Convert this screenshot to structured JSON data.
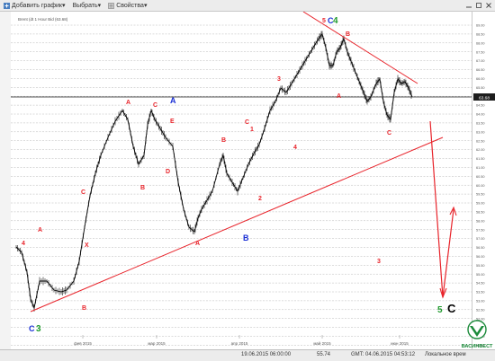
{
  "toolbar": {
    "add_chart_label": "Добавить график",
    "select_label": "Выбрать",
    "properties_label": "Свойства"
  },
  "chart": {
    "legend": "Brent (dt 1 Hour Bid (63.68)",
    "price_badge": "63.68",
    "x_labels": [
      "фев 2015",
      "мар 2015",
      "апр 2015",
      "май 2015",
      "июн 2015"
    ],
    "y_labels": [
      "69.00",
      "68.50",
      "68.00",
      "67.50",
      "67.00",
      "66.50",
      "66.00",
      "65.50",
      "65.00",
      "64.50",
      "64.00",
      "63.50",
      "63.00",
      "62.50",
      "62.00",
      "61.50",
      "61.00",
      "60.50",
      "60.00",
      "59.50",
      "59.00",
      "58.50",
      "58.00",
      "57.50",
      "57.00",
      "56.50",
      "56.00",
      "55.50",
      "55.00",
      "54.50",
      "53.50",
      "53.00",
      "52.50",
      "52.00",
      "51.50",
      "51.00",
      "50.50"
    ],
    "wave_labels_red": [
      "4",
      "A",
      "X",
      "C",
      "B",
      "A",
      "C",
      "E",
      "D",
      "B",
      "A",
      "B",
      "C",
      "2",
      "1",
      "3",
      "4",
      "3",
      "A",
      "B",
      "C",
      "5"
    ],
    "wave_labels_blue": [
      "A",
      "B",
      "C",
      "C"
    ],
    "wave_labels_green": [
      "3",
      "4",
      "5"
    ],
    "wave_labels_black": [
      "C"
    ],
    "colors": {
      "trendline": "#e8232a",
      "wave_red": "#e8232a",
      "wave_blue": "#1a2fd6",
      "wave_green": "#1f9a2d",
      "candles": "#000000",
      "grid": "#b8b8b8"
    }
  },
  "status": {
    "datetime": "19.06.2015 06:00:00",
    "price": "55.74",
    "gmt_time": "GMT: 04.06.2015 04:53:12",
    "local_label": "Локальное врем"
  },
  "brand": {
    "name": "ВАСИНВЕСТ"
  }
}
